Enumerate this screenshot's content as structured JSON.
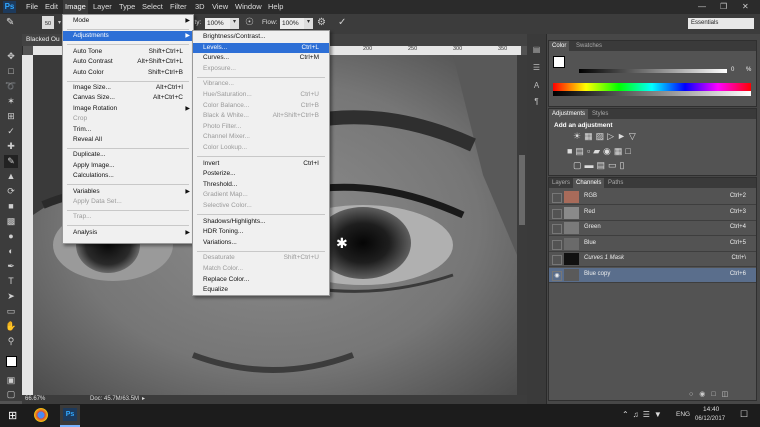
{
  "app": {
    "logo": "Ps"
  },
  "menubar": {
    "items": [
      "File",
      "Edit",
      "Image",
      "Layer",
      "Type",
      "Select",
      "Filter",
      "3D",
      "View",
      "Window",
      "Help"
    ],
    "active": "Image"
  },
  "options": {
    "brush_size": "50",
    "opacity_label": "ity:",
    "opacity_value": "100%",
    "flow_label": "Flow:",
    "flow_value": "100%",
    "workspace": "Essentials"
  },
  "document": {
    "tab_title": "Blacked Ou",
    "zoom": "66.67%",
    "doc_size": "Doc: 45.7M/63.5M",
    "ruler_ticks": [
      "150",
      "200",
      "250",
      "300",
      "350",
      "400",
      "450"
    ]
  },
  "image_menu": [
    {
      "label": "Mode",
      "shortcut": "",
      "submenu": true,
      "enabled": true
    },
    {
      "sep": true
    },
    {
      "label": "Adjustments",
      "shortcut": "",
      "submenu": true,
      "enabled": true,
      "highlight": true
    },
    {
      "sep": true
    },
    {
      "label": "Auto Tone",
      "shortcut": "Shift+Ctrl+L",
      "enabled": true
    },
    {
      "label": "Auto Contrast",
      "shortcut": "Alt+Shift+Ctrl+L",
      "enabled": true
    },
    {
      "label": "Auto Color",
      "shortcut": "Shift+Ctrl+B",
      "enabled": true
    },
    {
      "sep": true
    },
    {
      "label": "Image Size...",
      "shortcut": "Alt+Ctrl+I",
      "enabled": true
    },
    {
      "label": "Canvas Size...",
      "shortcut": "Alt+Ctrl+C",
      "enabled": true
    },
    {
      "label": "Image Rotation",
      "shortcut": "",
      "submenu": true,
      "enabled": true
    },
    {
      "label": "Crop",
      "shortcut": "",
      "enabled": false
    },
    {
      "label": "Trim...",
      "shortcut": "",
      "enabled": true
    },
    {
      "label": "Reveal All",
      "shortcut": "",
      "enabled": true
    },
    {
      "sep": true
    },
    {
      "label": "Duplicate...",
      "shortcut": "",
      "enabled": true
    },
    {
      "label": "Apply Image...",
      "shortcut": "",
      "enabled": true
    },
    {
      "label": "Calculations...",
      "shortcut": "",
      "enabled": true
    },
    {
      "sep": true
    },
    {
      "label": "Variables",
      "shortcut": "",
      "submenu": true,
      "enabled": true
    },
    {
      "label": "Apply Data Set...",
      "shortcut": "",
      "enabled": false
    },
    {
      "sep": true
    },
    {
      "label": "Trap...",
      "shortcut": "",
      "enabled": false
    },
    {
      "sep": true
    },
    {
      "label": "Analysis",
      "shortcut": "",
      "submenu": true,
      "enabled": true
    }
  ],
  "adjust_menu": [
    {
      "label": "Brightness/Contrast...",
      "shortcut": "",
      "enabled": true
    },
    {
      "label": "Levels...",
      "shortcut": "Ctrl+L",
      "enabled": true,
      "highlight": true
    },
    {
      "label": "Curves...",
      "shortcut": "Ctrl+M",
      "enabled": true
    },
    {
      "label": "Exposure...",
      "shortcut": "",
      "enabled": false
    },
    {
      "sep": true
    },
    {
      "label": "Vibrance...",
      "shortcut": "",
      "enabled": false
    },
    {
      "label": "Hue/Saturation...",
      "shortcut": "Ctrl+U",
      "enabled": false
    },
    {
      "label": "Color Balance...",
      "shortcut": "Ctrl+B",
      "enabled": false
    },
    {
      "label": "Black & White...",
      "shortcut": "Alt+Shift+Ctrl+B",
      "enabled": false
    },
    {
      "label": "Photo Filter...",
      "shortcut": "",
      "enabled": false
    },
    {
      "label": "Channel Mixer...",
      "shortcut": "",
      "enabled": false
    },
    {
      "label": "Color Lookup...",
      "shortcut": "",
      "enabled": false
    },
    {
      "sep": true
    },
    {
      "label": "Invert",
      "shortcut": "Ctrl+I",
      "enabled": true
    },
    {
      "label": "Posterize...",
      "shortcut": "",
      "enabled": true
    },
    {
      "label": "Threshold...",
      "shortcut": "",
      "enabled": true
    },
    {
      "label": "Gradient Map...",
      "shortcut": "",
      "enabled": false
    },
    {
      "label": "Selective Color...",
      "shortcut": "",
      "enabled": false
    },
    {
      "sep": true
    },
    {
      "label": "Shadows/Highlights...",
      "shortcut": "",
      "enabled": true
    },
    {
      "label": "HDR Toning...",
      "shortcut": "",
      "enabled": true
    },
    {
      "label": "Variations...",
      "shortcut": "",
      "enabled": true
    },
    {
      "sep": true
    },
    {
      "label": "Desaturate",
      "shortcut": "Shift+Ctrl+U",
      "enabled": false
    },
    {
      "label": "Match Color...",
      "shortcut": "",
      "enabled": false
    },
    {
      "label": "Replace Color...",
      "shortcut": "",
      "enabled": true
    },
    {
      "label": "Equalize",
      "shortcut": "",
      "enabled": true
    }
  ],
  "color_panel": {
    "tabs": [
      "Color",
      "Swatches"
    ],
    "slider_value": "0",
    "slider_unit": "%"
  },
  "adjustments_panel": {
    "tabs": [
      "Adjustments",
      "Styles"
    ],
    "heading": "Add an adjustment"
  },
  "layers_panel": {
    "tabs": [
      "Layers",
      "Channels",
      "Paths"
    ],
    "active_tab": "Channels",
    "rows": [
      {
        "name": "RGB",
        "shortcut": "Ctrl+2",
        "visible": false,
        "selected": false,
        "thumb": "#a86b5a"
      },
      {
        "name": "Red",
        "shortcut": "Ctrl+3",
        "visible": false,
        "selected": false,
        "thumb": "#8a8a8a"
      },
      {
        "name": "Green",
        "shortcut": "Ctrl+4",
        "visible": false,
        "selected": false,
        "thumb": "#7a7a7a"
      },
      {
        "name": "Blue",
        "shortcut": "Ctrl+5",
        "visible": false,
        "selected": false,
        "thumb": "#6a6a6a"
      },
      {
        "name": "Curves 1 Mask",
        "shortcut": "Ctrl+\\",
        "visible": false,
        "selected": false,
        "thumb": "#111111",
        "italic": true
      },
      {
        "name": "Blue copy",
        "shortcut": "Ctrl+6",
        "visible": true,
        "selected": true,
        "thumb": "#5a5a5a"
      }
    ]
  },
  "taskbar": {
    "time": "14:40",
    "date": "06/12/2017",
    "lang": "ENG"
  },
  "colors": {
    "accent": "#2d6fd6",
    "selected_row": "#5a6e8c"
  }
}
